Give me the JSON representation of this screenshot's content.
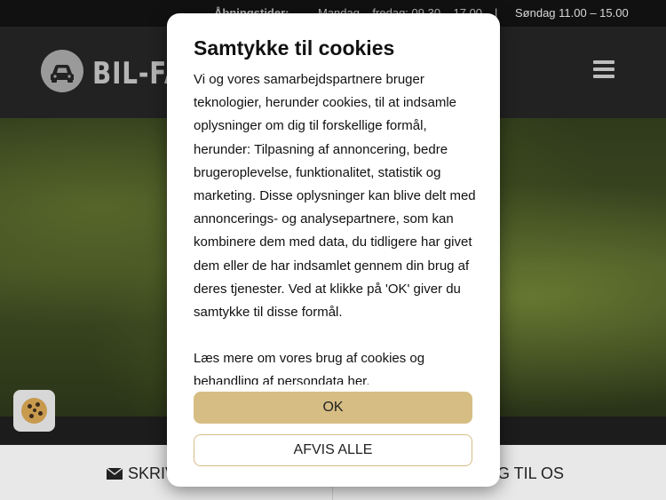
{
  "topbar": {
    "hours_label": "Åbningstider:",
    "weekdays": "Mandag – fredag: 09.30 – 17.00",
    "separator": "|",
    "sunday": "Søndag 11.00 – 15.00"
  },
  "header": {
    "logo_text": "BIL-FA"
  },
  "bottom_bar": {
    "left_label": "SKRIV",
    "right_label": "G TIL OS"
  },
  "cookie_modal": {
    "title": "Samtykke til cookies",
    "paragraph1": "Vi og vores samarbejdspartnere bruger teknologier, herunder cookies, til at indsamle oplysninger om dig til forskellige formål, herunder: Tilpasning af annoncering, bedre brugeroplevelse, funktionalitet, statistik og marketing. Disse oplysninger kan blive delt med annoncerings- og analysepartnere, som kan kombinere dem med data, du tidligere har givet dem eller de har indsamlet gennem din brug af deres tjenester. Ved at klikke på 'OK' giver du samtykke til disse formål.",
    "paragraph2": "Læs mere om vores brug af cookies og behandling af persondata her.",
    "ok_label": "OK",
    "reject_label": "AFVIS ALLE"
  },
  "colors": {
    "accent": "#d6bd84",
    "header_bg": "#222222"
  }
}
